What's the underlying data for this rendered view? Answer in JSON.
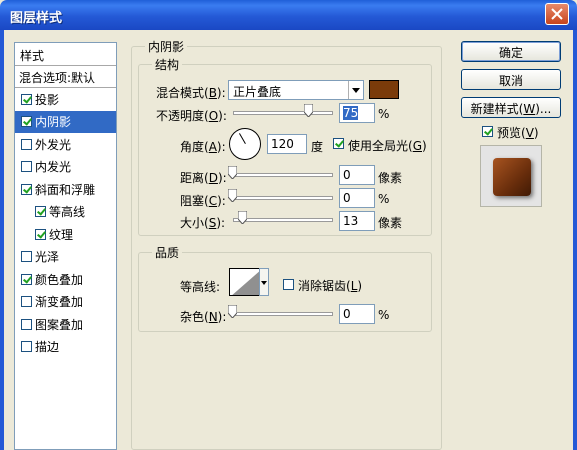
{
  "window": {
    "title": "图层样式"
  },
  "style_list": {
    "header": "样式",
    "blend_options": "混合选项:默认",
    "items": [
      {
        "label": "投影",
        "checked": true,
        "selected": false,
        "indent": false
      },
      {
        "label": "内阴影",
        "checked": true,
        "selected": true,
        "indent": false
      },
      {
        "label": "外发光",
        "checked": false,
        "selected": false,
        "indent": false
      },
      {
        "label": "内发光",
        "checked": false,
        "selected": false,
        "indent": false
      },
      {
        "label": "斜面和浮雕",
        "checked": true,
        "selected": false,
        "indent": false
      },
      {
        "label": "等高线",
        "checked": true,
        "selected": false,
        "indent": true
      },
      {
        "label": "纹理",
        "checked": true,
        "selected": false,
        "indent": true
      },
      {
        "label": "光泽",
        "checked": false,
        "selected": false,
        "indent": false
      },
      {
        "label": "颜色叠加",
        "checked": true,
        "selected": false,
        "indent": false
      },
      {
        "label": "渐变叠加",
        "checked": false,
        "selected": false,
        "indent": false
      },
      {
        "label": "图案叠加",
        "checked": false,
        "selected": false,
        "indent": false
      },
      {
        "label": "描边",
        "checked": false,
        "selected": false,
        "indent": false
      }
    ]
  },
  "inner_shadow": {
    "section_title": "内阴影",
    "structure_title": "结构",
    "blend_mode_label": "混合模式(",
    "blend_mode_key": "B",
    "blend_mode_value": "正片叠底",
    "shadow_color": "#7a3b0a",
    "opacity_label": "不透明度(",
    "opacity_key": "O",
    "opacity_value": "75",
    "opacity_unit": "%",
    "opacity_level": 0.75,
    "angle_label": "角度(",
    "angle_key": "A",
    "angle_value": "120",
    "angle_unit": "度",
    "global_light_label": "使用全局光(",
    "global_light_key": "G",
    "global_light_checked": true,
    "distance_label": "距离(",
    "distance_key": "D",
    "distance_value": "0",
    "distance_unit": "像素",
    "choke_label": "阻塞(",
    "choke_key": "C",
    "choke_value": "0",
    "choke_unit": "%",
    "size_label": "大小(",
    "size_key": "S",
    "size_value": "13",
    "size_unit": "像素"
  },
  "quality": {
    "title": "品质",
    "contour_label": "等高线:",
    "antialias_label": "消除锯齿(",
    "antialias_key": "L",
    "antialias_checked": false,
    "noise_label": "杂色(",
    "noise_key": "N",
    "noise_value": "0",
    "noise_unit": "%"
  },
  "buttons": {
    "ok": "确定",
    "cancel": "取消",
    "new_style_prefix": "新建样式(",
    "new_style_key": "W",
    "new_style_suffix": ")...",
    "preview_label": "预览(",
    "preview_key": "V",
    "preview_checked": true
  }
}
